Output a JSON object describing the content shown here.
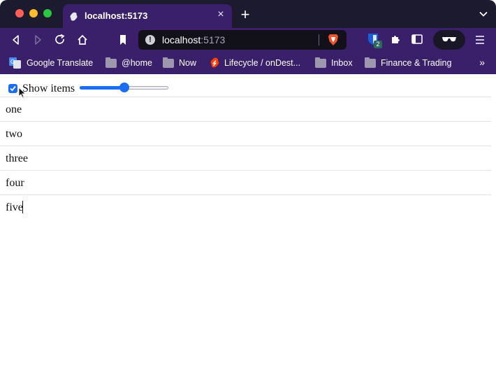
{
  "browser": {
    "tab_title": "localhost:5173",
    "url_host": "localhost",
    "url_port": ":5173",
    "extension_badge": "2",
    "bookmarks": [
      {
        "label": "Google Translate",
        "icon": "google-translate-icon"
      },
      {
        "label": "@home",
        "icon": "folder-icon"
      },
      {
        "label": "Now",
        "icon": "folder-icon"
      },
      {
        "label": "Lifecycle / onDest...",
        "icon": "svelte-icon"
      },
      {
        "label": "Inbox",
        "icon": "folder-icon"
      },
      {
        "label": "Finance & Trading",
        "icon": "folder-icon"
      }
    ],
    "overflow": "»"
  },
  "page": {
    "checkbox_label": "Show items",
    "checkbox_checked": true,
    "slider_value": 0.5,
    "items": [
      "one",
      "two",
      "three",
      "four",
      "five"
    ]
  },
  "colors": {
    "accent": "#1b6ef3",
    "toolbar": "#3a1f6b",
    "tabstrip": "#1b1a2e"
  }
}
